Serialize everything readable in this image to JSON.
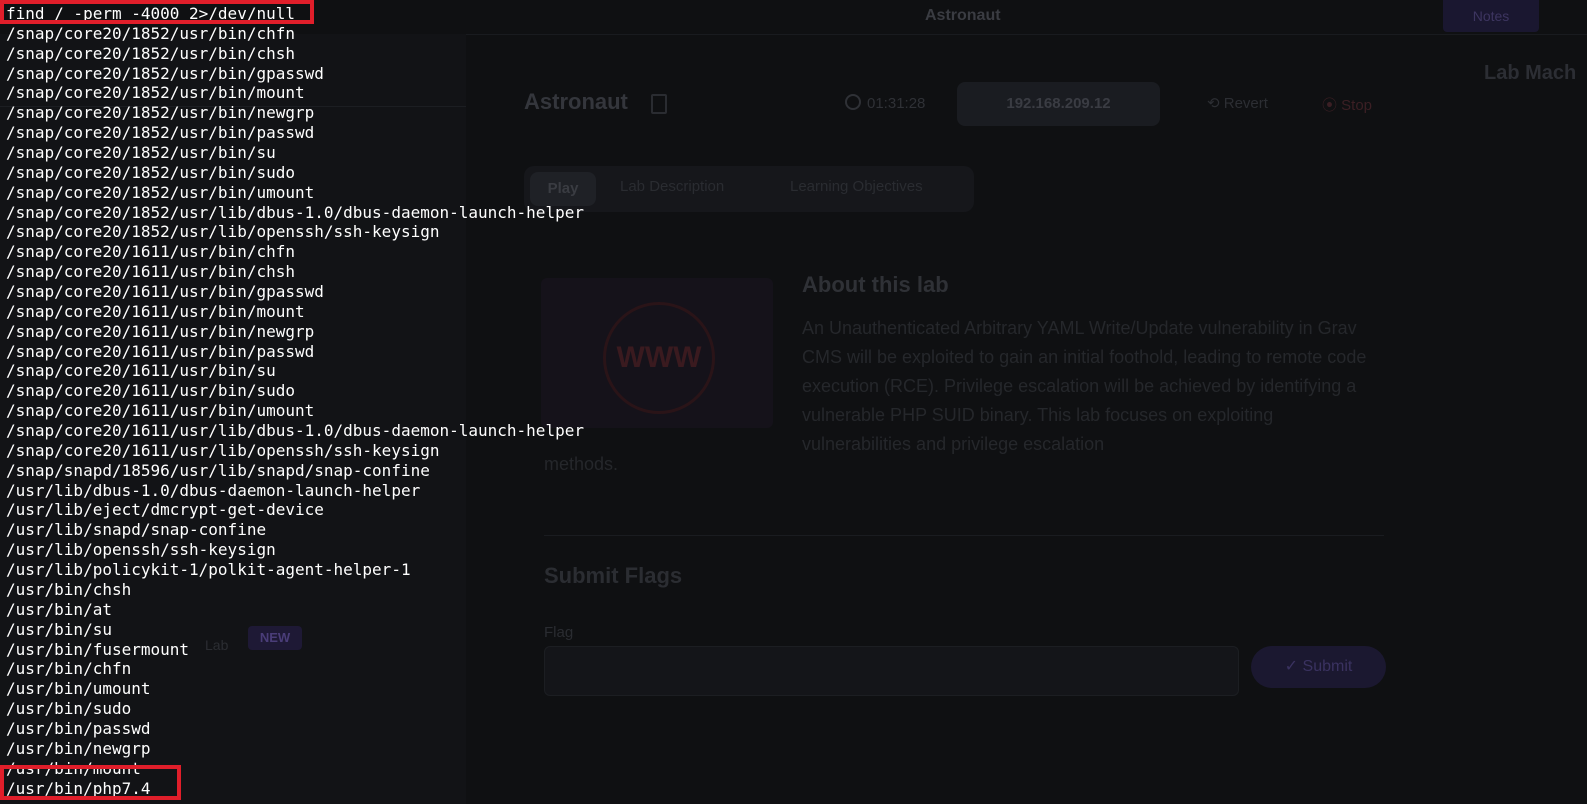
{
  "background_app": {
    "window_title": "Astronaut",
    "notes_button": "Notes",
    "sidebar_new_lab_label": "Lab",
    "new_badge": "NEW",
    "right_panel_title": "Lab Mach",
    "lab_name": "Astronaut",
    "timer": "01:31:28",
    "ip_address": "192.168.209.12",
    "revert_label": "Revert",
    "stop_label": "Stop",
    "tabs": [
      "Play",
      "Lab Description",
      "Learning Objectives"
    ],
    "image_text": "WWW",
    "about_title": "About this lab",
    "about_text": "An Unauthenticated Arbitrary YAML Write/Update vulnerability in Grav CMS will be exploited to gain an initial foothold, leading to remote code execution (RCE). Privilege escalation will be achieved by identifying a vulnerable PHP SUID binary. This lab focuses on exploiting vulnerabilities and privilege escalation",
    "about_text_tail": "methods.",
    "submit_title": "Submit Flags",
    "flag_label": "Flag",
    "submit_button": "Submit"
  },
  "terminal": {
    "command": "find / -perm -4000 2>/dev/null",
    "output": [
      "/snap/core20/1852/usr/bin/chfn",
      "/snap/core20/1852/usr/bin/chsh",
      "/snap/core20/1852/usr/bin/gpasswd",
      "/snap/core20/1852/usr/bin/mount",
      "/snap/core20/1852/usr/bin/newgrp",
      "/snap/core20/1852/usr/bin/passwd",
      "/snap/core20/1852/usr/bin/su",
      "/snap/core20/1852/usr/bin/sudo",
      "/snap/core20/1852/usr/bin/umount",
      "/snap/core20/1852/usr/lib/dbus-1.0/dbus-daemon-launch-helper",
      "/snap/core20/1852/usr/lib/openssh/ssh-keysign",
      "/snap/core20/1611/usr/bin/chfn",
      "/snap/core20/1611/usr/bin/chsh",
      "/snap/core20/1611/usr/bin/gpasswd",
      "/snap/core20/1611/usr/bin/mount",
      "/snap/core20/1611/usr/bin/newgrp",
      "/snap/core20/1611/usr/bin/passwd",
      "/snap/core20/1611/usr/bin/su",
      "/snap/core20/1611/usr/bin/sudo",
      "/snap/core20/1611/usr/bin/umount",
      "/snap/core20/1611/usr/lib/dbus-1.0/dbus-daemon-launch-helper",
      "/snap/core20/1611/usr/lib/openssh/ssh-keysign",
      "/snap/snapd/18596/usr/lib/snapd/snap-confine",
      "/usr/lib/dbus-1.0/dbus-daemon-launch-helper",
      "/usr/lib/eject/dmcrypt-get-device",
      "/usr/lib/snapd/snap-confine",
      "/usr/lib/openssh/ssh-keysign",
      "/usr/lib/policykit-1/polkit-agent-helper-1",
      "/usr/bin/chsh",
      "/usr/bin/at",
      "/usr/bin/su",
      "/usr/bin/fusermount",
      "/usr/bin/chfn",
      "/usr/bin/umount",
      "/usr/bin/sudo",
      "/usr/bin/passwd",
      "/usr/bin/newgrp",
      "/usr/bin/mount",
      "/usr/bin/php7.4"
    ]
  },
  "colors": {
    "terminal_bg": "#0f1012",
    "terminal_text": "#ffffff",
    "highlight_box": "#e01e2a"
  }
}
